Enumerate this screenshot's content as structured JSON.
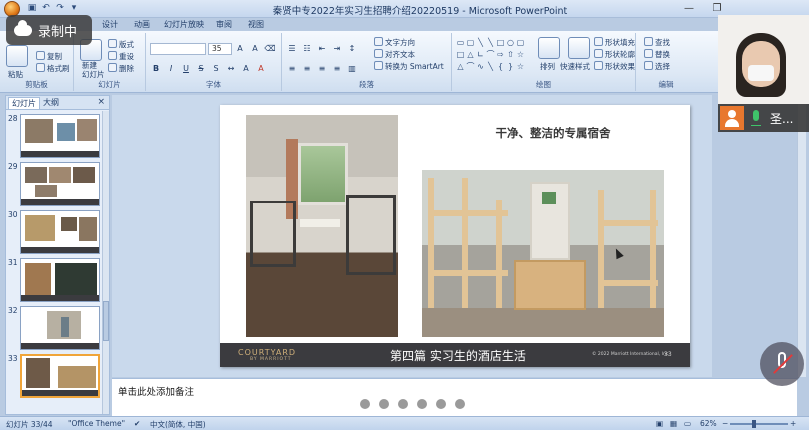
{
  "window": {
    "title": "秦贤中专2022年实习生招聘介绍20220519 - Microsoft PowerPoint"
  },
  "recording": {
    "label": "录制中"
  },
  "ribbon": {
    "tabs": [
      "设计",
      "动画",
      "幻灯片放映",
      "审阅",
      "视图"
    ],
    "clipboard": {
      "paste": "粘贴",
      "copy": "复制",
      "format_painter": "格式刷",
      "label": "剪贴板"
    },
    "slides": {
      "new_slide": "新建\n幻灯片",
      "layout": "版式",
      "reset": "重设",
      "delete": "删除",
      "label": "幻灯片"
    },
    "font": {
      "size": "35",
      "label": "字体"
    },
    "paragraph": {
      "text_direction": "文字方向",
      "align_text": "对齐文本",
      "smartart": "转换为 SmartArt",
      "label": "段落"
    },
    "drawing": {
      "arrange": "排列",
      "quick_styles": "快速样式",
      "shape_fill": "形状填充",
      "shape_outline": "形状轮廓",
      "shape_effects": "形状效果",
      "label": "绘图"
    },
    "editing": {
      "find": "查找",
      "replace": "替换",
      "select": "选择",
      "label": "编辑"
    }
  },
  "pane": {
    "tabs": [
      "幻灯片",
      "大纲"
    ],
    "close": "×",
    "slides": [
      {
        "num": "28",
        "active": false
      },
      {
        "num": "29",
        "active": false
      },
      {
        "num": "30",
        "active": false
      },
      {
        "num": "31",
        "active": false
      },
      {
        "num": "32",
        "active": false
      },
      {
        "num": "33",
        "active": true
      }
    ]
  },
  "slide": {
    "title": "干净、整洁的专属宿舍",
    "footer_brand": "COURTYARD",
    "footer_brand_sub": "BY MARRIOTT",
    "footer_title": "第四篇 实习生的酒店生活",
    "footer_copyright": "© 2022 Marriott International, Inc.",
    "footer_page": "33"
  },
  "notes": {
    "placeholder": "单击此处添加备注"
  },
  "pager_dots": 6,
  "status": {
    "slide_index": "幻灯片 33/44",
    "theme": "\"Office Theme\"",
    "language": "中文(简体, 中国)",
    "zoom": "62%"
  },
  "video": {
    "name": "圣..."
  },
  "colors": {
    "accent_orange": "#e8772e",
    "mic_green": "#3fc46a",
    "footer_dark": "#3b3b3f"
  }
}
